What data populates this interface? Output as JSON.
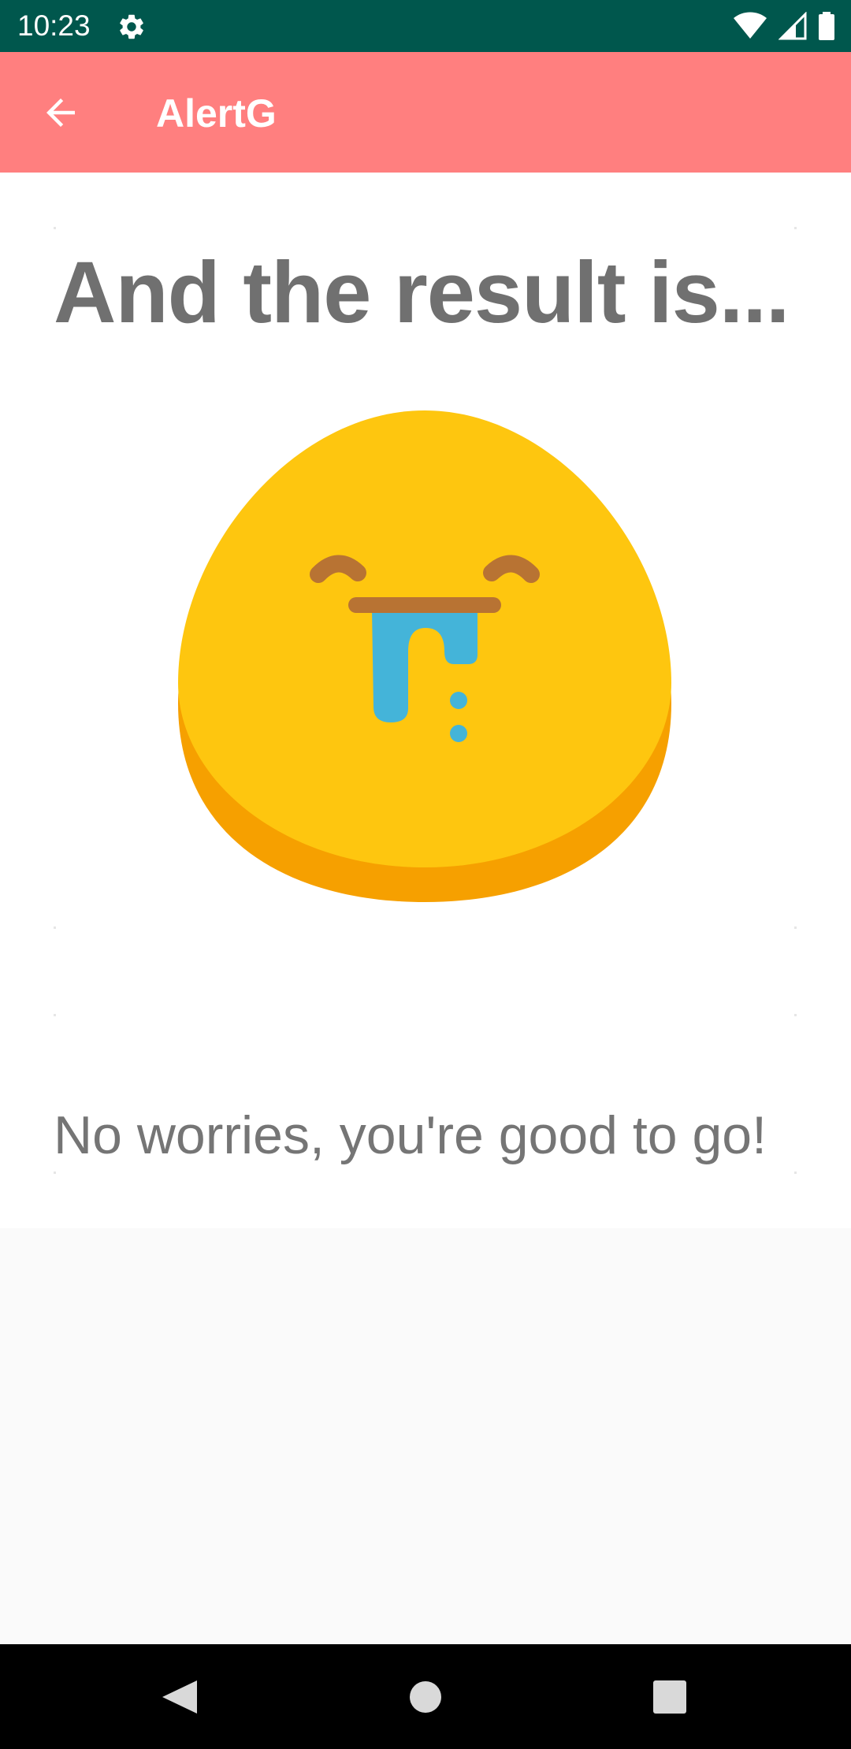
{
  "status_bar": {
    "time": "10:23",
    "icons": [
      "settings-gear-icon",
      "wifi-icon",
      "cell-signal-icon",
      "battery-icon"
    ]
  },
  "app_bar": {
    "title": "AlertG",
    "back_icon": "arrow-back-icon",
    "color": "#ff7f7f"
  },
  "result": {
    "heading": "And the result is...",
    "emoji_icon": "drooling-face-emoji",
    "message": "No worries, you're good to go!"
  },
  "nav_bar": {
    "buttons": [
      "back-triangle-icon",
      "home-circle-icon",
      "recents-square-icon"
    ]
  },
  "colors": {
    "status_bar": "#00574d",
    "accent": "#ff7f7f",
    "emoji_face": "#fec60f",
    "emoji_shadow": "#f6a000",
    "emoji_features": "#b87333",
    "emoji_drool": "#44b4d9",
    "heading_text": "#707070"
  }
}
